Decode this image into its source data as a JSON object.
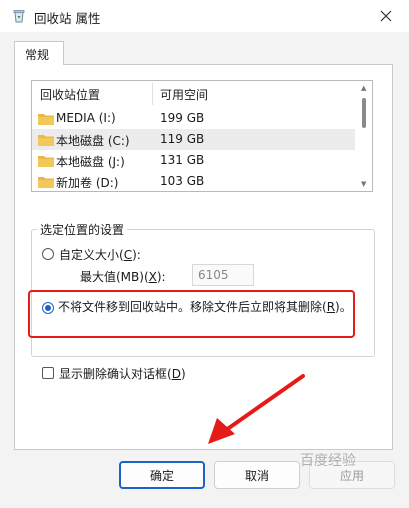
{
  "window": {
    "title": "回收站 属性"
  },
  "tabs": [
    {
      "label": "常规"
    }
  ],
  "drive_list": {
    "headers": {
      "location": "回收站位置",
      "space": "可用空间"
    },
    "rows": [
      {
        "name": "MEDIA (I:)",
        "space": "199 GB"
      },
      {
        "name": "本地磁盘 (C:)",
        "space": "119 GB"
      },
      {
        "name": "本地磁盘 (J:)",
        "space": "131 GB"
      },
      {
        "name": "新加卷 (D:)",
        "space": "103 GB"
      }
    ]
  },
  "settings": {
    "group_label": "选定位置的设置",
    "custom_size": {
      "label": "自定义大小",
      "accel": "C",
      "suffix": "):"
    },
    "max_value": {
      "label": "最大值(MB)",
      "accel": "X",
      "suffix": "):",
      "value": "6105"
    },
    "no_recycle": {
      "label": "不将文件移到回收站中。移除文件后立即将其删除",
      "accel": "R",
      "suffix": ")。"
    }
  },
  "confirm_dialog": {
    "label": "显示删除确认对话框",
    "accel": "D",
    "suffix": ")"
  },
  "buttons": {
    "ok": "确定",
    "cancel": "取消",
    "apply": "应用"
  },
  "watermark": "百度经验",
  "colors": {
    "accent": "#1a64c8",
    "highlight_box": "#e41b17",
    "annotation_arrow": "#e41b17",
    "folder": "#e8b84a"
  }
}
